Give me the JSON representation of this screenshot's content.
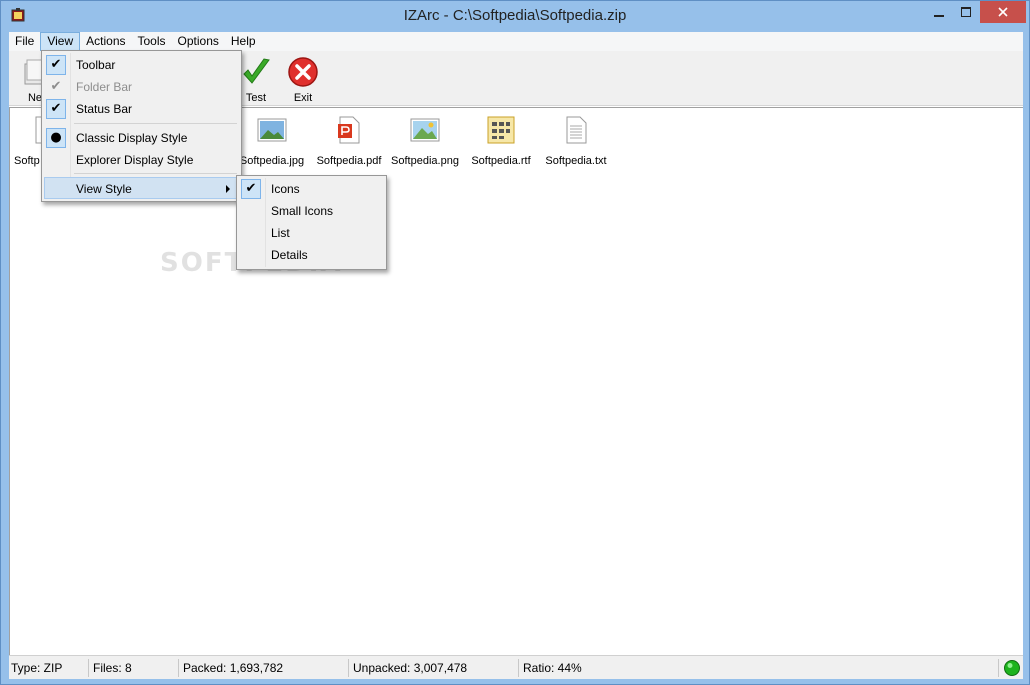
{
  "window": {
    "title": "IZArc - C:\\Softpedia\\Softpedia.zip"
  },
  "menubar": [
    "File",
    "View",
    "Actions",
    "Tools",
    "Options",
    "Help"
  ],
  "toolbar": {
    "new_label": "Ne",
    "test_label": "Test",
    "exit_label": "Exit"
  },
  "files": [
    {
      "name": "Softp",
      "icon": "document-icon"
    },
    {
      "name": "Softpedia.jpg",
      "icon": "image-icon"
    },
    {
      "name": "Softpedia.pdf",
      "icon": "pdf-icon"
    },
    {
      "name": "Softpedia.png",
      "icon": "image-icon"
    },
    {
      "name": "Softpedia.rtf",
      "icon": "rtf-icon"
    },
    {
      "name": "Softpedia.txt",
      "icon": "text-icon"
    }
  ],
  "view_menu": {
    "toolbar": "Toolbar",
    "folder_bar": "Folder Bar",
    "status_bar": "Status Bar",
    "classic": "Classic Display Style",
    "explorer": "Explorer Display Style",
    "view_style": "View Style"
  },
  "view_style_menu": {
    "icons": "Icons",
    "small_icons": "Small Icons",
    "list": "List",
    "details": "Details"
  },
  "status": {
    "type": "Type: ZIP",
    "files": "Files: 8",
    "packed": "Packed: 1,693,782",
    "unpacked": "Unpacked: 3,007,478",
    "ratio": "Ratio: 44%"
  },
  "watermark": "SOFTPEDIA",
  "colors": {
    "title_bar": "#96c0ea",
    "close_button": "#c7504b",
    "menu_highlight": "#cde4f7",
    "status_ok": "#1db31d"
  }
}
